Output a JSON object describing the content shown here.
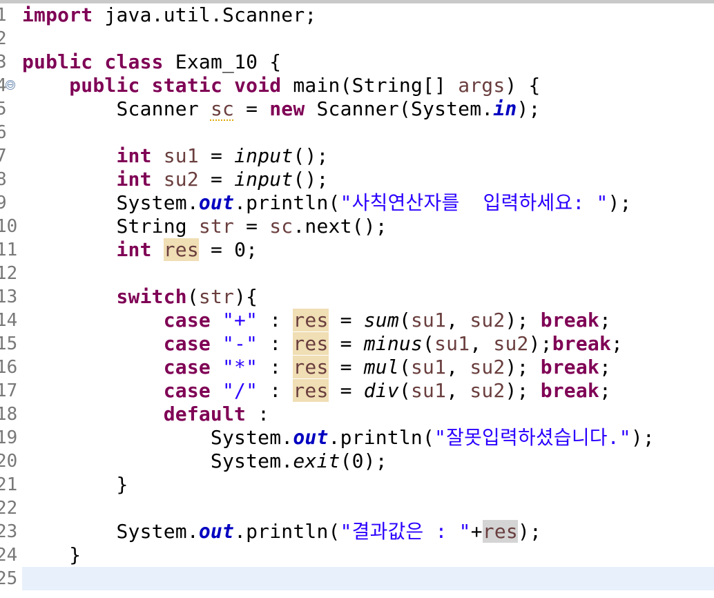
{
  "editor": {
    "gutter": {
      "line_numbers": [
        "1",
        "2",
        "3",
        "4",
        "5",
        "6",
        "7",
        "8",
        "9",
        "10",
        "11",
        "12",
        "13",
        "14",
        "15",
        "16",
        "17",
        "18",
        "19",
        "20",
        "21",
        "22",
        "23",
        "24",
        "25"
      ],
      "fold_icon_symbol": "⊖"
    },
    "code": {
      "import_kw": "import",
      "import_rest": " java.util.Scanner;",
      "public": "public",
      "class": "class",
      "class_name": " Exam_10 {",
      "static": "static",
      "void": "void",
      "main_sig_a": " main(String[] ",
      "args": "args",
      "main_sig_b": ") {",
      "scanner_type": "Scanner ",
      "sc": "sc",
      "assign": " = ",
      "new": "new",
      "scanner_ctor": " Scanner(System.",
      "in": "in",
      "close_paren_semi": ");",
      "int": "int",
      "su1": "su1",
      "su2": "su2",
      "input_call": "input",
      "empty_call": "();",
      "system_dot": "System.",
      "out": "out",
      "println_open": ".println(",
      "prompt_str": "\"사칙연산자를  입력하세요: \"",
      "string_type": "String ",
      "str": "str",
      "sc_next": ".next();",
      "res": "res",
      "zero_semi": " = 0;",
      "switch": "switch",
      "switch_rest": "){",
      "case": "case",
      "plus_str": "\"+\"",
      "minus_str": "\"-\"",
      "mul_str": "\"*\"",
      "div_str": "\"/\"",
      "colon": " : ",
      "sum": "sum",
      "minus": "minus",
      "mul": "mul",
      "div": "div",
      "args_open": "(",
      "comma": ", ",
      "close_semi": ");",
      "break": "break",
      "semi": ";",
      "default": "default",
      "default_colon": " :",
      "error_str": "\"잘못입력하셨습니다.\"",
      "exit": "exit",
      "exit_args": "(0);",
      "close_brace": "}",
      "result_str": "\"결과값은 : \"",
      "plus_op": "+"
    }
  }
}
